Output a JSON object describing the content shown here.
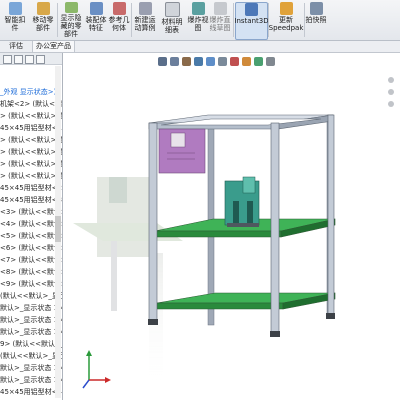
{
  "ribbon": {
    "buttons": [
      {
        "label": "智能扣\n件"
      },
      {
        "label": "移动零\n部件"
      },
      {
        "label": "显示隐\n藏的零\n部件"
      },
      {
        "label": "装配体\n特征"
      },
      {
        "label": "参考几\n何体"
      },
      {
        "label": "新建运\n动算例"
      },
      {
        "label": "材料明\n细表"
      },
      {
        "label": "爆炸视\n图"
      },
      {
        "label": "爆炸直\n线草图"
      },
      {
        "label": "Instant3D"
      },
      {
        "label": "更新\nSpeedpak"
      },
      {
        "label": "拍快照"
      }
    ]
  },
  "tabs": [
    {
      "label": "评估"
    },
    {
      "label": "办公室产品"
    }
  ],
  "tree": {
    "rows": [
      "_外观 显示状态>)",
      "机架<2> (默认<<默",
      "> (默认<<默认>_显",
      "45×45用铝型材<1> (",
      "> (默认<<默认>_显",
      "> (默认<<默认>_显",
      "> (默认<<默认>_显",
      "> (默认<<默认>_显",
      "45×45用铝型材<2> (",
      "45×45用铝型材<3> (",
      "<3> (默认<<默认>_",
      "<4> (默认<<默认>_",
      "<5> (默认<<默认>_",
      "<6> (默认<<默认>_",
      "<7> (默认<<默认>_",
      "<8> (默认<<默认>_",
      "<9> (默认<<默认>_",
      "(默认<<默认>_显示",
      "默认>_显示状态 1>)",
      "默认>_显示状态 1>)",
      "默认>_显示状态 1>)",
      "9> (默认<<默认>_显",
      "(默认<<默认>_显示",
      "默认>_显示状态 1>)",
      "默认>_显示状态 1>)",
      "45×45用铝型材<4> ("
    ]
  },
  "view": {
    "hud_icons": [
      "zoom-to-fit-icon",
      "zoom-area-icon",
      "previous-view-icon",
      "section-view-icon",
      "view-orientation-icon",
      "display-style-icon",
      "hide-show-icon",
      "edit-appearance-icon",
      "apply-scene-icon",
      "view-settings-icon"
    ],
    "colors": {
      "frame": "#b9c3cf",
      "shelf": "#2fa84a",
      "panel": "#b07bc0",
      "fixture": "#3a9c8c"
    }
  }
}
